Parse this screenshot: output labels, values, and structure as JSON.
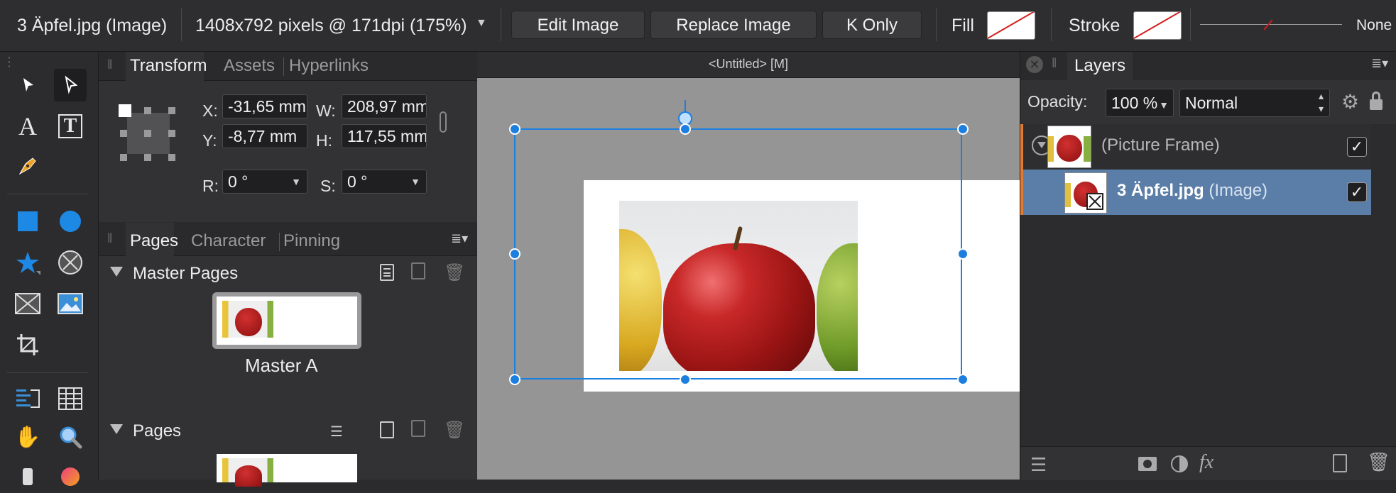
{
  "toolbar": {
    "doc_name": "3 Äpfel.jpg (Image)",
    "dimensions": "1408x792 pixels @ 171dpi (175%)",
    "edit_image": "Edit Image",
    "replace_image": "Replace Image",
    "k_only": "K Only",
    "fill_label": "Fill",
    "stroke_label": "Stroke",
    "stroke_none": "None"
  },
  "transform_panel": {
    "tabs": [
      "Transform",
      "Assets",
      "Hyperlinks"
    ],
    "x_label": "X:",
    "x_value": "-31,65 mm",
    "y_label": "Y:",
    "y_value": "-8,77 mm",
    "w_label": "W:",
    "w_value": "208,97 mm",
    "h_label": "H:",
    "h_value": "117,55 mm",
    "r_label": "R:",
    "r_value": "0 °",
    "s_label": "S:",
    "s_value": "0 °"
  },
  "pages_panel": {
    "tabs": [
      "Pages",
      "Character",
      "Pinning"
    ],
    "master_pages_title": "Master Pages",
    "master_name": "Master A",
    "pages_title": "Pages"
  },
  "canvas": {
    "doc_title": "<Untitled> [M]"
  },
  "layers_panel": {
    "tab": "Layers",
    "opacity_label": "Opacity:",
    "opacity_value": "100 %",
    "blend_mode": "Normal",
    "layers": [
      {
        "name": "(Picture Frame)",
        "type": ""
      },
      {
        "name": "3 Äpfel.jpg",
        "type": "(Image)"
      }
    ]
  },
  "colors": {
    "accent": "#1c7fe0",
    "selected_layer": "#5b7ea8",
    "layer_marker": "#e07a2e"
  }
}
